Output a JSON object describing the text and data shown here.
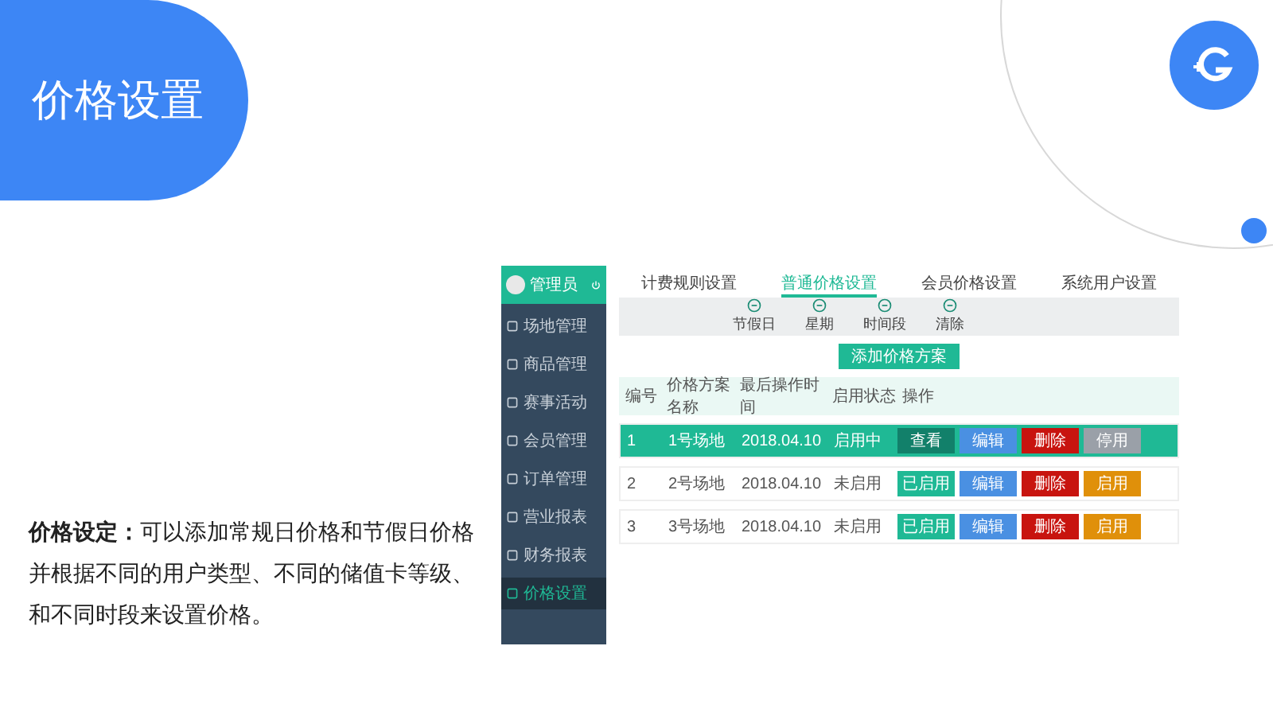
{
  "slide_title": "价格设置",
  "description": {
    "lead": "价格设定：",
    "body": "可以添加常规日价格和节假日价格并根据不同的用户类型、不同的储值卡等级、和不同时段来设置价格。"
  },
  "app": {
    "user": {
      "name": "管理员"
    },
    "sidebar": {
      "items": [
        {
          "label": "场地管理",
          "selected": false
        },
        {
          "label": "商品管理",
          "selected": false
        },
        {
          "label": "赛事活动",
          "selected": false
        },
        {
          "label": "会员管理",
          "selected": false
        },
        {
          "label": "订单管理",
          "selected": false
        },
        {
          "label": "营业报表",
          "selected": false
        },
        {
          "label": "财务报表",
          "selected": false
        },
        {
          "label": "价格设置",
          "selected": true
        }
      ]
    },
    "tabs": [
      {
        "label": "计费规则设置",
        "selected": false
      },
      {
        "label": "普通价格设置",
        "selected": true
      },
      {
        "label": "会员价格设置",
        "selected": false
      },
      {
        "label": "系统用户设置",
        "selected": false
      }
    ],
    "toolbar": [
      {
        "label": "节假日"
      },
      {
        "label": "星期"
      },
      {
        "label": "时间段"
      },
      {
        "label": "清除"
      }
    ],
    "add_button": "添加价格方案",
    "table": {
      "columns": [
        "编号",
        "价格方案名称",
        "最后操作时间",
        "启用状态",
        "操作"
      ],
      "rows": [
        {
          "selected": true,
          "cells": [
            "1",
            "1号场地",
            "2018.04.10",
            "启用中"
          ],
          "actions": [
            {
              "kind": "view",
              "label": "查看"
            },
            {
              "kind": "edit",
              "label": "编辑"
            },
            {
              "kind": "delete",
              "label": "删除"
            },
            {
              "kind": "disable",
              "label": "停用"
            }
          ]
        },
        {
          "selected": false,
          "cells": [
            "2",
            "2号场地",
            "2018.04.10",
            "未启用"
          ],
          "actions": [
            {
              "kind": "enabled",
              "label": "已启用"
            },
            {
              "kind": "edit",
              "label": "编辑"
            },
            {
              "kind": "delete",
              "label": "删除"
            },
            {
              "kind": "enable",
              "label": "启用"
            }
          ]
        },
        {
          "selected": false,
          "cells": [
            "3",
            "3号场地",
            "2018.04.10",
            "未启用"
          ],
          "actions": [
            {
              "kind": "enabled",
              "label": "已启用"
            },
            {
              "kind": "edit",
              "label": "编辑"
            },
            {
              "kind": "delete",
              "label": "删除"
            },
            {
              "kind": "enable",
              "label": "启用"
            }
          ]
        }
      ]
    }
  }
}
